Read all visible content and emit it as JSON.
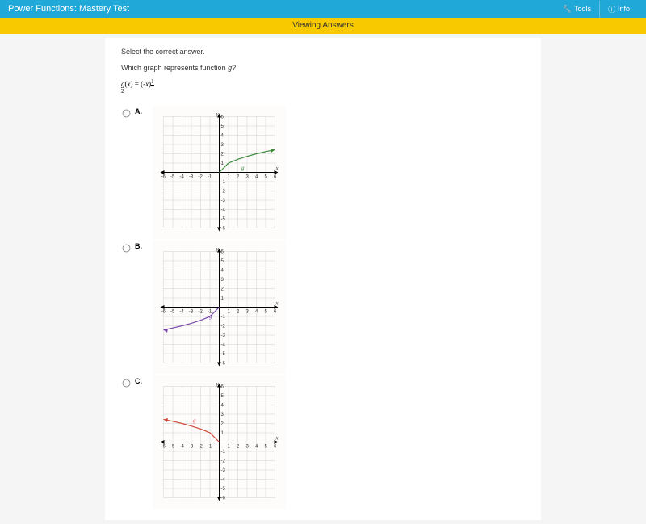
{
  "header": {
    "title": "Power Functions: Mastery Test",
    "tools_label": "Tools",
    "info_label": "Info"
  },
  "status": {
    "text": "Viewing Answers"
  },
  "question": {
    "instruction": "Select the correct answer.",
    "prompt_prefix": "Which graph represents function ",
    "prompt_var": "g",
    "prompt_suffix": "?",
    "formula_lhs_var": "g",
    "formula_lhs_arg": "x",
    "formula_eq": " = ",
    "formula_rhs_base_prefix": "(-",
    "formula_rhs_base_var": "x",
    "formula_rhs_base_suffix": ")",
    "formula_exp_num": "1",
    "formula_exp_den": "2"
  },
  "options": {
    "a_label": "A.",
    "b_label": "B.",
    "c_label": "C."
  },
  "graph": {
    "x_label": "x",
    "y_label": "y",
    "g_label": "g",
    "ticks_pos": [
      "1",
      "2",
      "3",
      "4",
      "5",
      "6"
    ],
    "ticks_neg": [
      "-1",
      "-2",
      "-3",
      "-4",
      "-5",
      "-6"
    ]
  },
  "chart_data": [
    {
      "type": "line",
      "option": "A",
      "xlim": [
        -6,
        6
      ],
      "ylim": [
        -6,
        6
      ],
      "series": [
        {
          "name": "g",
          "color": "#3a8a3a",
          "domain": [
            0,
            6
          ],
          "formula": "sqrt(x)"
        }
      ],
      "points": [
        [
          0,
          0
        ],
        [
          1,
          1
        ],
        [
          2,
          1.41
        ],
        [
          3,
          1.73
        ],
        [
          4,
          2
        ],
        [
          5,
          2.24
        ],
        [
          6,
          2.45
        ]
      ]
    },
    {
      "type": "line",
      "option": "B",
      "xlim": [
        -6,
        6
      ],
      "ylim": [
        -6,
        6
      ],
      "series": [
        {
          "name": "g",
          "color": "#7a4aaa",
          "domain": [
            -6,
            0
          ],
          "formula": "-sqrt(-x)"
        }
      ],
      "points": [
        [
          -6,
          -2.45
        ],
        [
          -5,
          -2.24
        ],
        [
          -4,
          -2
        ],
        [
          -3,
          -1.73
        ],
        [
          -2,
          -1.41
        ],
        [
          -1,
          -1
        ],
        [
          0,
          0
        ]
      ]
    },
    {
      "type": "line",
      "option": "C",
      "xlim": [
        -6,
        6
      ],
      "ylim": [
        -6,
        6
      ],
      "series": [
        {
          "name": "g",
          "color": "#d04a3a",
          "domain": [
            -6,
            0
          ],
          "formula": "sqrt(-x)"
        }
      ],
      "points": [
        [
          -6,
          2.45
        ],
        [
          -5,
          2.24
        ],
        [
          -4,
          2
        ],
        [
          -3,
          1.73
        ],
        [
          -2,
          1.41
        ],
        [
          -1,
          1
        ],
        [
          0,
          0
        ]
      ]
    }
  ]
}
